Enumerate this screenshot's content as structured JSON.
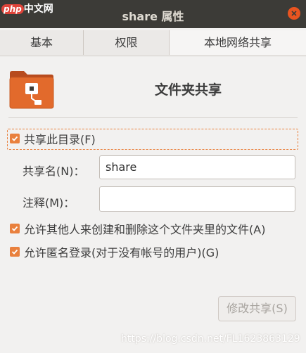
{
  "window": {
    "title": "share 属性"
  },
  "watermark": {
    "brand": "php",
    "site": "中文网",
    "url": "https://blog.csdn.net/FL1623863129"
  },
  "tabs": [
    {
      "label": "基本",
      "active": false
    },
    {
      "label": "权限",
      "active": false
    },
    {
      "label": "本地网络共享",
      "active": true
    }
  ],
  "section": {
    "heading": "文件夹共享"
  },
  "share_folder": {
    "label": "共享此目录(F)",
    "checked": true
  },
  "share_name": {
    "label": "共享名(N)：",
    "value": "share"
  },
  "comment": {
    "label": "注释(M)：",
    "value": ""
  },
  "allow_others": {
    "label": "允许其他人来创建和删除这个文件夹里的文件(A)",
    "checked": true
  },
  "guest_access": {
    "label": "允许匿名登录(对于没有帐号的用户)(G)",
    "checked": true
  },
  "modify_button": {
    "label": "修改共享(S)",
    "enabled": false
  },
  "colors": {
    "accent": "#e95420",
    "checkbox": "#e9803d",
    "titlebar": "#3c3b37"
  }
}
